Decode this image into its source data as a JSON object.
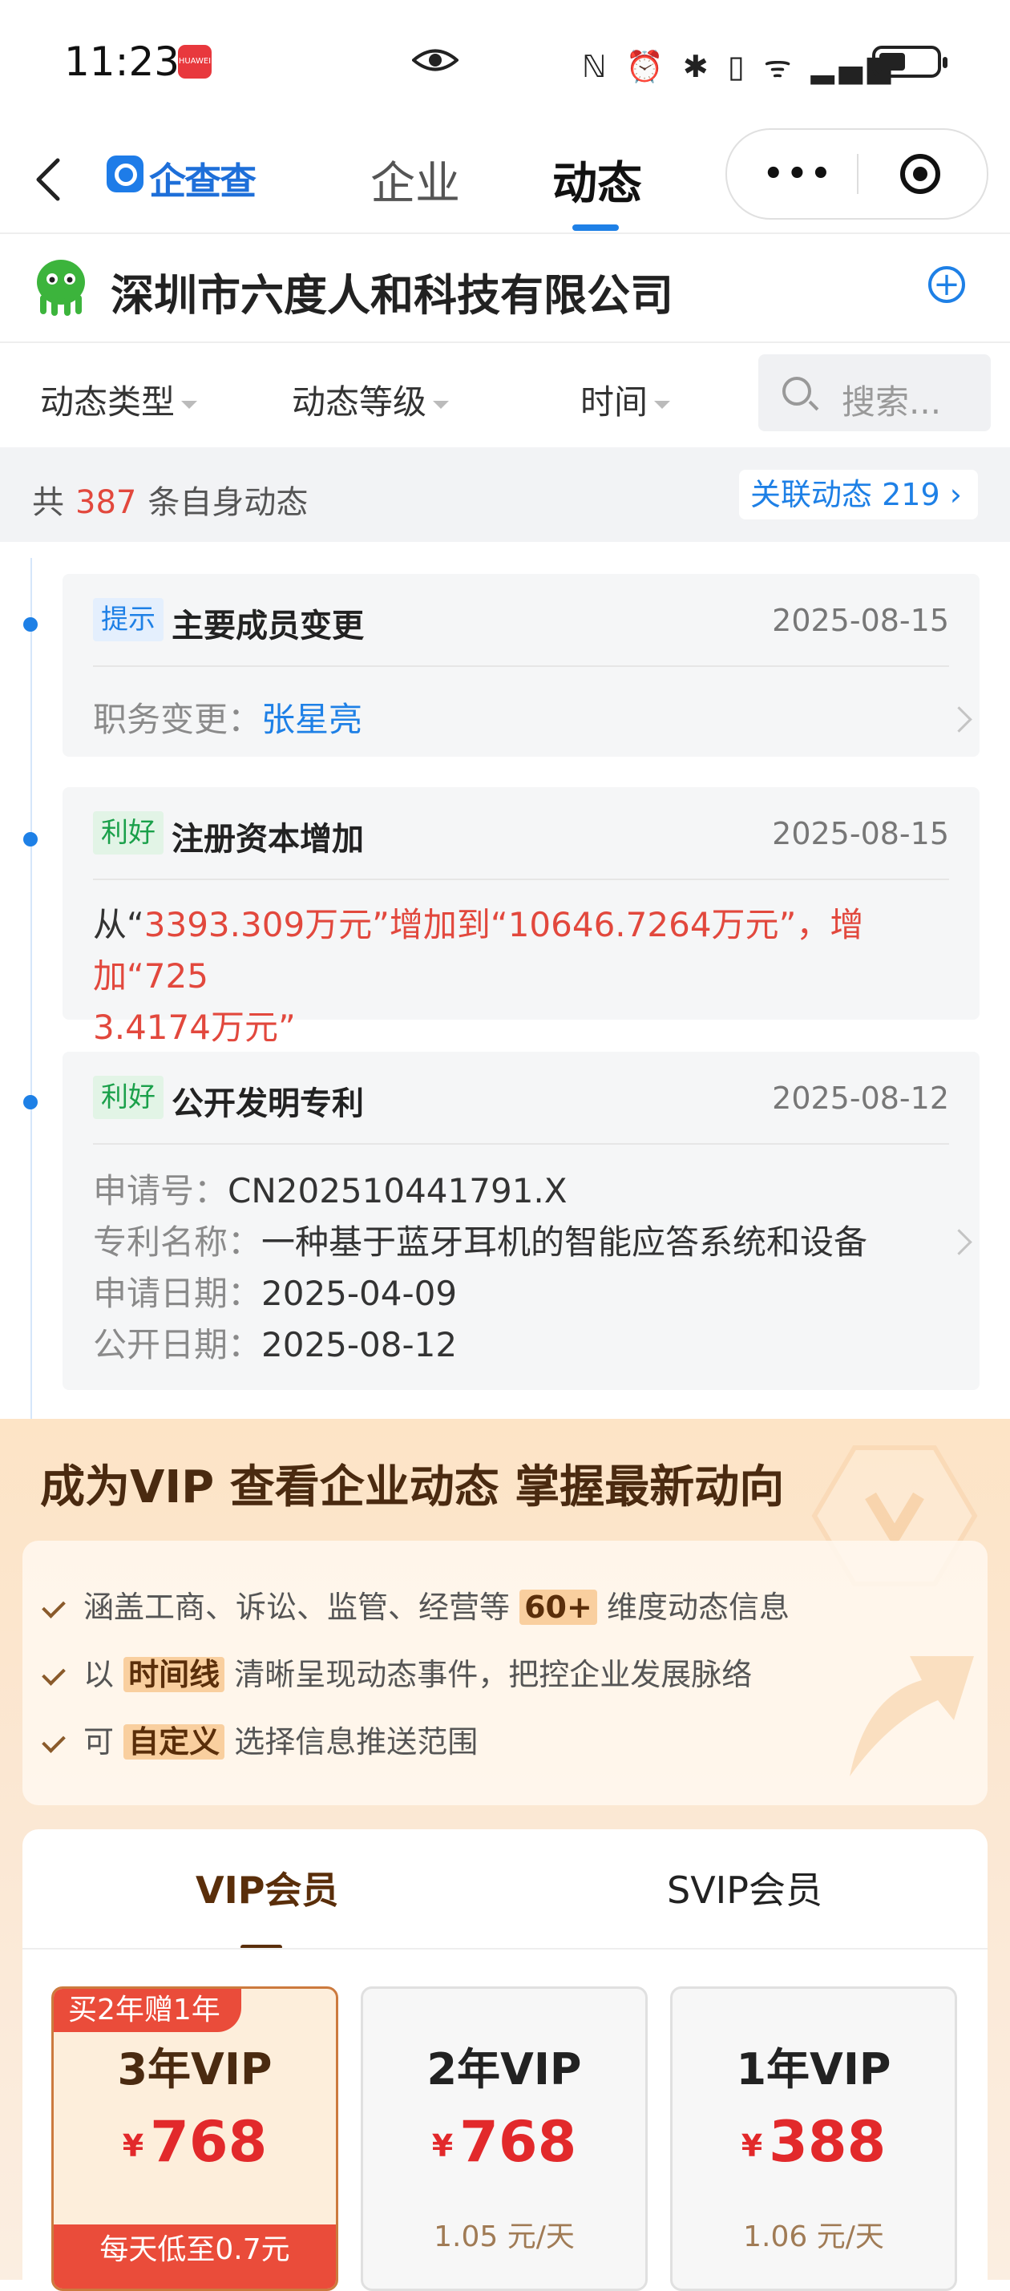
{
  "status_bar": {
    "time": "11:23",
    "huawei_label": "HUAWEI",
    "icons_text": "ℕ ⏰ ✱ ▯ ᯤ ▂▄▆"
  },
  "nav": {
    "logo": "企查查",
    "tabs": [
      "企业",
      "动态"
    ],
    "active_tab": "动态"
  },
  "company": {
    "name": "深圳市六度人和科技有限公司",
    "mascot_color": "#3cb43c"
  },
  "filters": {
    "items": [
      "动态类型",
      "动态等级",
      "时间"
    ],
    "search_placeholder": "搜索..."
  },
  "summary": {
    "prefix": "共",
    "count": "387",
    "suffix": "条自身动态",
    "related_label": "关联动态",
    "related_count": "219"
  },
  "timeline": [
    {
      "tag": "提示",
      "title": "主要成员变更",
      "date": "2025-08-15",
      "label": "职务变更：",
      "value": "张星亮"
    },
    {
      "tag": "利好",
      "title": "注册资本增加",
      "date": "2025-08-15",
      "text_from": "从“",
      "from_value": "3393.309万元",
      "text_mid": "”增加到“",
      "to_value": "10646.7264万元",
      "text_inc": "”，增加“",
      "inc_value_line1": "725",
      "inc_value_line2": "3.4174万元",
      "text_end": "”"
    },
    {
      "tag": "利好",
      "title": "公开发明专利",
      "date": "2025-08-12",
      "fields": [
        {
          "label": "申请号：",
          "value": "CN202510441791.X"
        },
        {
          "label": "专利名称：",
          "value": "一种基于蓝牙耳机的智能应答系统和设备"
        },
        {
          "label": "申请日期：",
          "value": "2025-04-09"
        },
        {
          "label": "公开日期：",
          "value": "2025-08-12"
        }
      ]
    }
  ],
  "vip": {
    "headline": "成为VIP 查看企业动态 掌握最新动向",
    "benefits": [
      {
        "pre": "涵盖工商、诉讼、监管、经营等",
        "hl": "60+",
        "post": "维度动态信息"
      },
      {
        "pre": "以",
        "hl": "时间线",
        "post": "清晰呈现动态事件，把控企业发展脉络"
      },
      {
        "pre": "可",
        "hl": "自定义",
        "post": "选择信息推送范围"
      }
    ],
    "tabs": [
      "VIP会员",
      "SVIP会员"
    ],
    "plans": [
      {
        "ribbon": "买2年赠1年",
        "name": "3年VIP",
        "currency": "¥",
        "price": "768",
        "per_day": "",
        "bottom": "每天低至0.7元"
      },
      {
        "name": "2年VIP",
        "currency": "¥",
        "price": "768",
        "per_day": "1.05 元/天"
      },
      {
        "name": "1年VIP",
        "currency": "¥",
        "price": "388",
        "per_day": "1.06 元/天"
      }
    ]
  }
}
